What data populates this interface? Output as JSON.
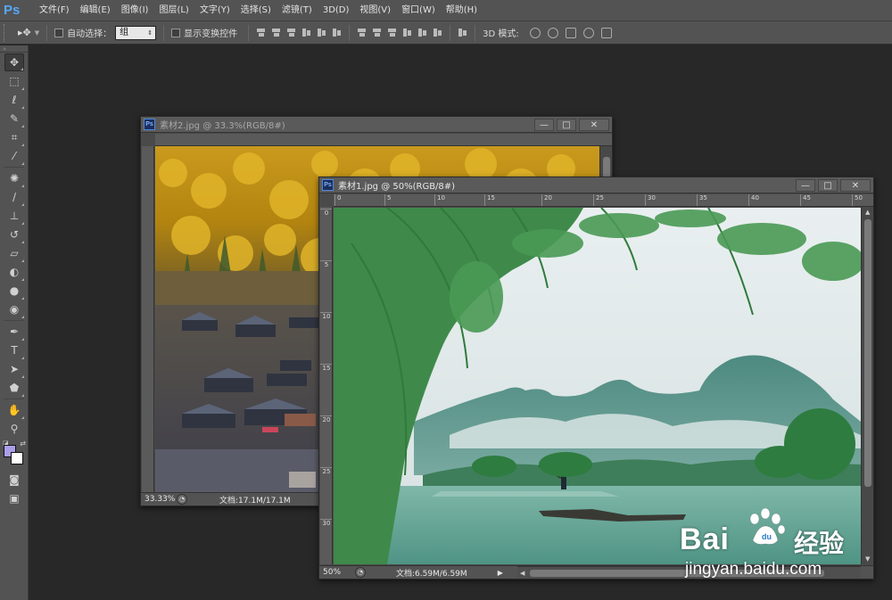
{
  "app": {
    "logo": "Ps"
  },
  "menubar": {
    "items": [
      "文件(F)",
      "编辑(E)",
      "图像(I)",
      "图层(L)",
      "文字(Y)",
      "选择(S)",
      "滤镜(T)",
      "3D(D)",
      "视图(V)",
      "窗口(W)",
      "帮助(H)"
    ]
  },
  "options": {
    "tool_icon": "move-tool-icon",
    "auto_select_label": "自动选择：",
    "auto_select_value": "组",
    "show_transform_label": "显示变换控件",
    "mode3d_label": "3D 模式:"
  },
  "toolbar": {
    "tools": [
      "move",
      "marquee",
      "lasso",
      "quick-select",
      "crop",
      "eyedropper",
      "spot-healing",
      "brush",
      "clone-stamp",
      "history-brush",
      "eraser",
      "paint-bucket",
      "blur",
      "dodge",
      "pen",
      "type",
      "path-select",
      "shape",
      "hand",
      "zoom"
    ],
    "foreground_color": "#aa9ee8",
    "background_color": "#ffffff"
  },
  "window2": {
    "title": "素材2.jpg @ 33.3%(RGB/8#)",
    "zoom": "33.33%",
    "doc_size": "文档:17.1M/17.1M"
  },
  "window1": {
    "title": "素材1.jpg @ 50%(RGB/8#)",
    "zoom": "50%",
    "doc_size": "文档:6.59M/6.59M",
    "ruler_h": [
      "0",
      "5",
      "10",
      "15",
      "20",
      "25",
      "30",
      "35",
      "40",
      "45",
      "50"
    ],
    "ruler_v": [
      "0",
      "5",
      "10",
      "15",
      "20",
      "25",
      "30"
    ]
  },
  "window_buttons": {
    "minimize": "—",
    "maximize": "□",
    "close": "✕"
  },
  "watermark": {
    "brand": "Bai",
    "brand_cn": "经验",
    "url": "jingyan.baidu.com"
  }
}
